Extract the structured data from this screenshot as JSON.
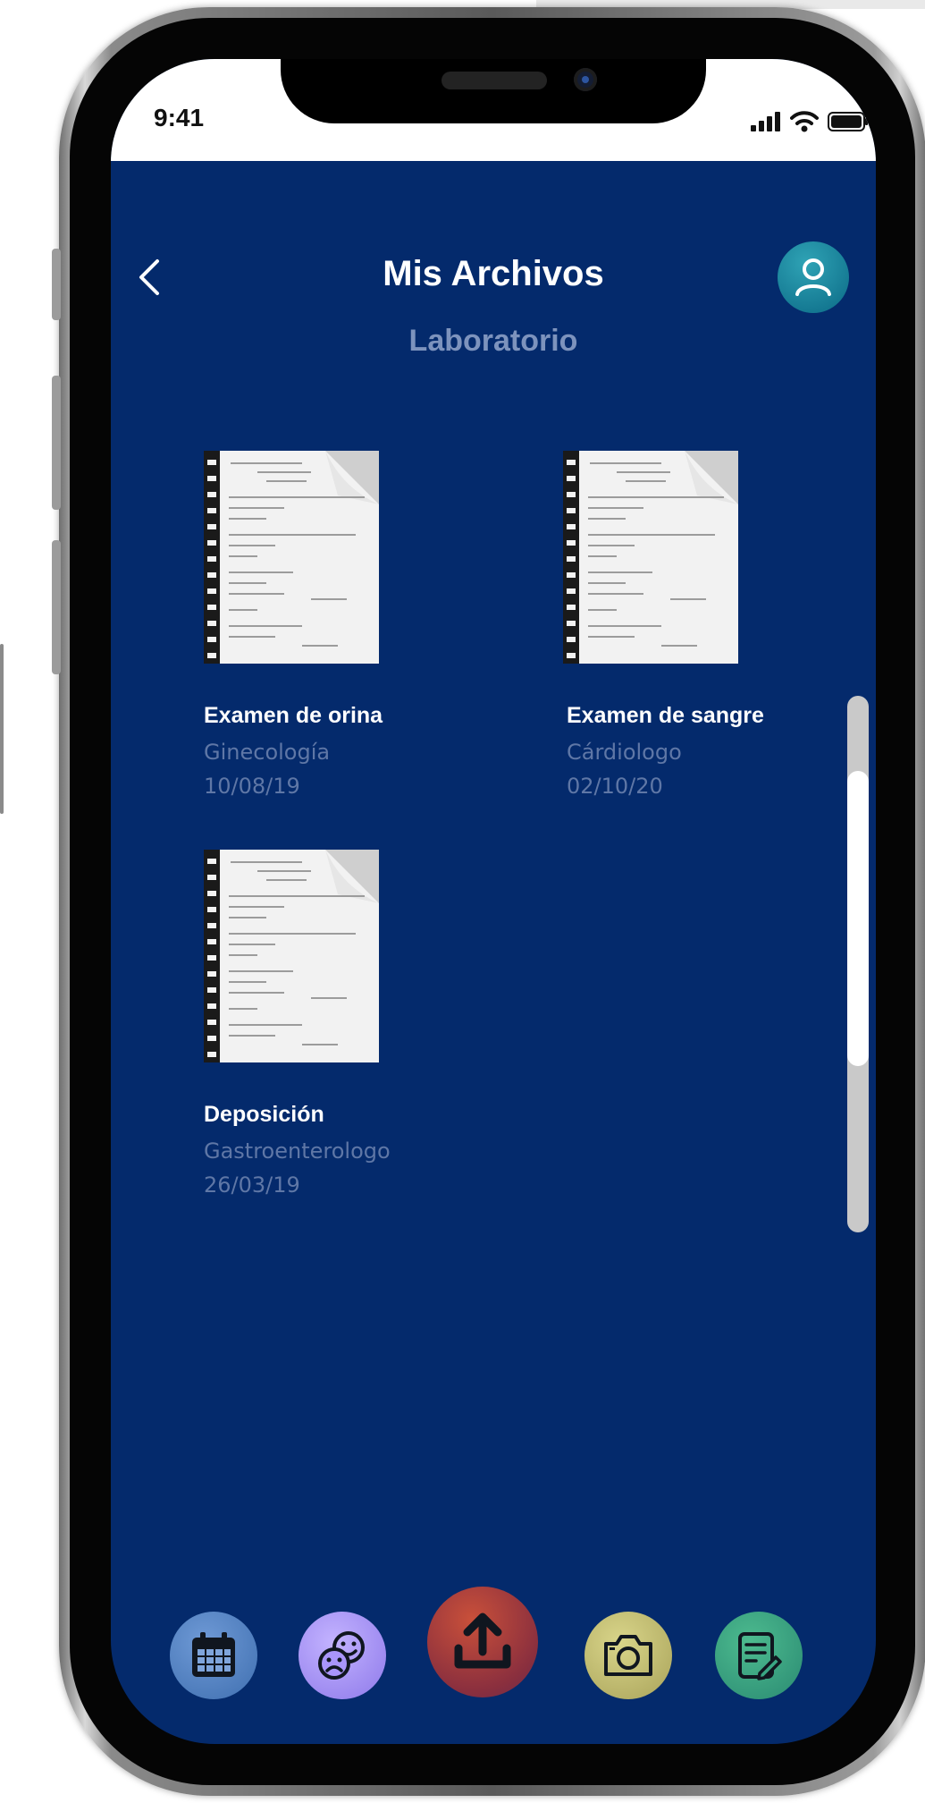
{
  "status_bar": {
    "time": "9:41"
  },
  "header": {
    "title": "Mis Archivos",
    "subtitle": "Laboratorio"
  },
  "files": [
    {
      "title": "Examen de orina",
      "category": "Ginecología",
      "date": "10/08/19"
    },
    {
      "title": "Examen de sangre",
      "category": "Cárdiologo",
      "date": "02/10/20"
    },
    {
      "title": "Deposición",
      "category": "Gastroenterologo",
      "date": "26/03/19"
    }
  ],
  "bottom_nav": [
    {
      "icon": "calendar-icon",
      "color": "#4f7fc3"
    },
    {
      "icon": "mood-faces-icon",
      "color": "#a18ff0"
    },
    {
      "icon": "upload-icon",
      "color": "#c0473a"
    },
    {
      "icon": "camera-icon",
      "color": "#c7c36f"
    },
    {
      "icon": "note-edit-icon",
      "color": "#3aa583"
    }
  ],
  "colors": {
    "screen_background": "#042a6c",
    "subtitle": "#7d93bd",
    "secondary_text": "#5f77a6"
  }
}
